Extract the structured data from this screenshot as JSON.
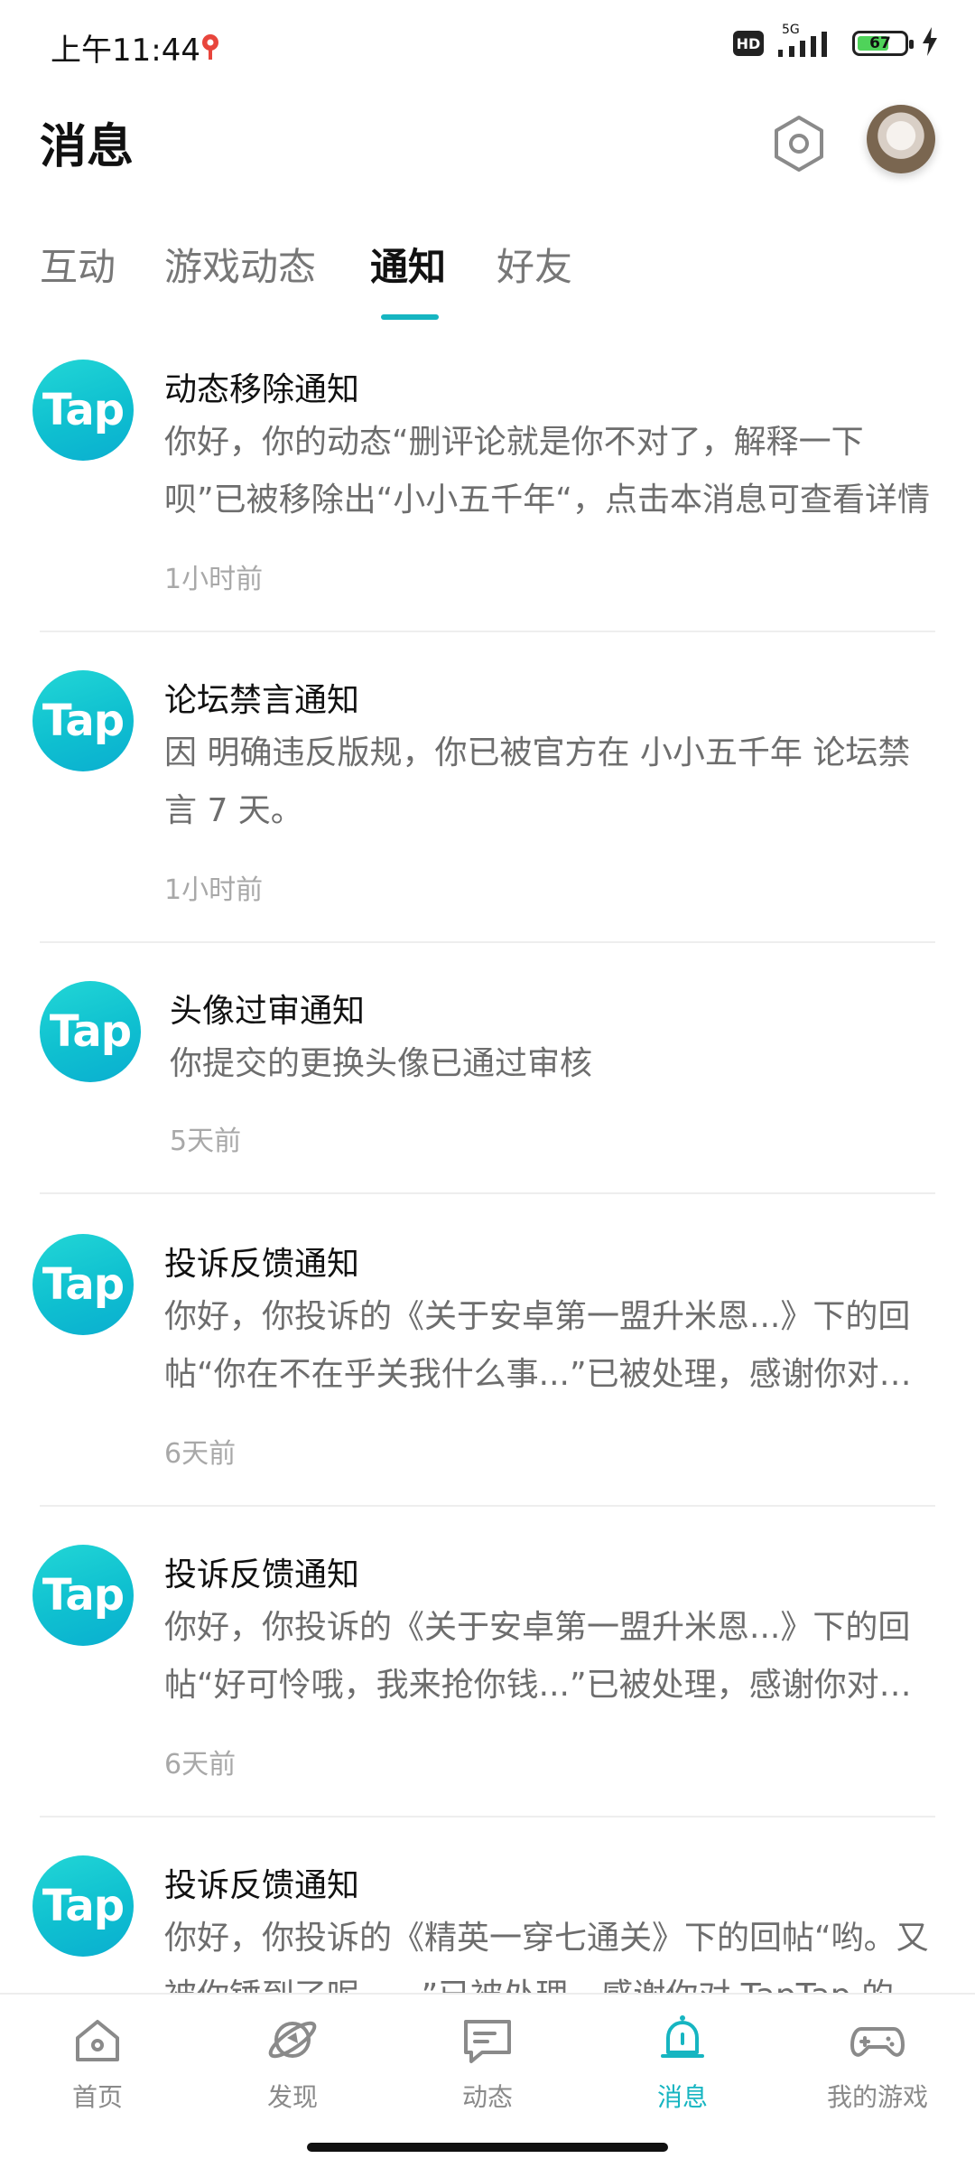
{
  "status_bar": {
    "time": "上午11:44",
    "network": "5G",
    "hd": "HD",
    "battery": "67",
    "battery_level": 0.67
  },
  "header": {
    "title": "消息"
  },
  "tabs": [
    {
      "label": "互动",
      "active": false
    },
    {
      "label": "游戏动态",
      "active": false
    },
    {
      "label": "通知",
      "active": true
    },
    {
      "label": "好友",
      "active": false
    }
  ],
  "notifications": [
    {
      "logo": "Tap",
      "title": "动态移除通知",
      "body": "你好，你的动态“删评论就是你不对了，解释一下呗”已被移除出“小小五千年“，点击本消息可查看详情",
      "time": "1小时前"
    },
    {
      "logo": "Tap",
      "title": "论坛禁言通知",
      "body": "因 明确违反版规，你已被官方在 小小五千年 论坛禁言 7 天。",
      "time": "1小时前"
    },
    {
      "logo": "Tap",
      "title": "头像过审通知",
      "body": "你提交的更换头像已通过审核",
      "time": "5天前"
    },
    {
      "logo": "Tap",
      "title": "投诉反馈通知",
      "body": "你好，你投诉的《关于安卓第一盟升米恩...》下的回帖“你在不在乎关我什么事...”已被处理，感谢你对TapTap的支持",
      "time": "6天前"
    },
    {
      "logo": "Tap",
      "title": "投诉反馈通知",
      "body": "你好，你投诉的《关于安卓第一盟升米恩...》下的回帖“好可怜哦，我来抢你钱...”已被处理，感谢你对TapTap的支持",
      "time": "6天前"
    },
    {
      "logo": "Tap",
      "title": "投诉反馈通知",
      "body": "你好，你投诉的《精英一穿七通关》下的回帖“哟。又被你锤到了呢......”已被处理，感谢你对 TapTap 的支持",
      "time": ""
    }
  ],
  "bottom_nav": [
    {
      "label": "首页",
      "icon": "home-icon",
      "active": false
    },
    {
      "label": "发现",
      "icon": "planet-icon",
      "active": false
    },
    {
      "label": "动态",
      "icon": "chat-bubble-icon",
      "active": false
    },
    {
      "label": "消息",
      "icon": "bell-icon",
      "active": true
    },
    {
      "label": "我的游戏",
      "icon": "gamepad-icon",
      "active": false
    }
  ],
  "colors": {
    "accent": "#16b5c1",
    "tap_logo": "#12c4d2",
    "secondary_text": "#6d6d6d",
    "time_text": "#a8a8a8"
  }
}
